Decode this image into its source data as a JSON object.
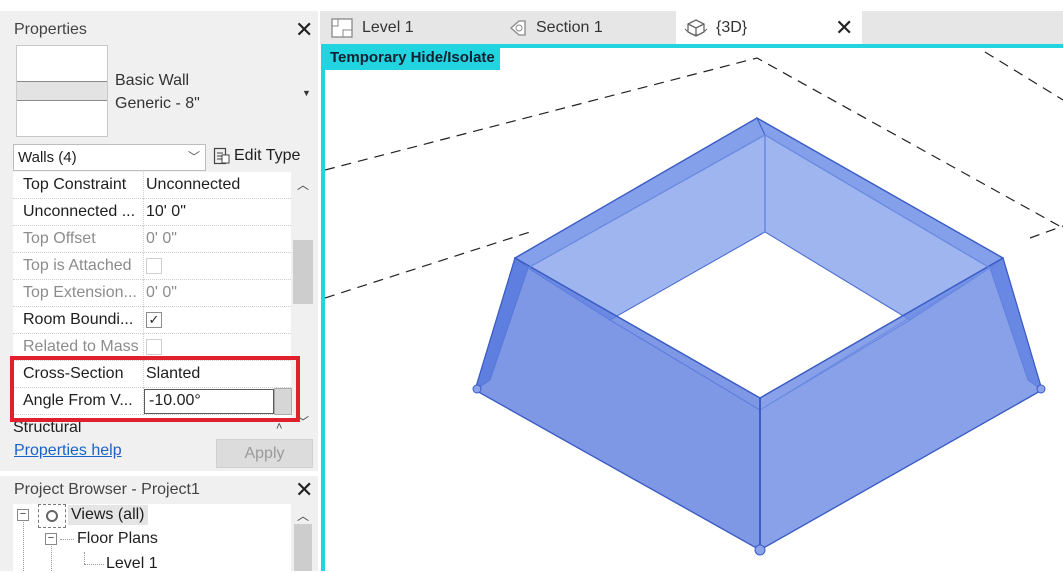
{
  "properties": {
    "title": "Properties",
    "type_family": "Basic Wall",
    "type_name": "Generic - 8\"",
    "selector": "Walls (4)",
    "edit_type": "Edit Type",
    "rows": [
      {
        "name": "Top Constraint",
        "value": "Unconnected",
        "disabled": false
      },
      {
        "name": "Unconnected ...",
        "value": "10'  0\"",
        "disabled": false
      },
      {
        "name": "Top Offset",
        "value": "0'  0\"",
        "disabled": true
      },
      {
        "name": "Top is Attached",
        "checked": false,
        "disabled": true
      },
      {
        "name": "Top Extension...",
        "value": "0'  0\"",
        "disabled": true
      },
      {
        "name": "Room Boundi...",
        "checked": true,
        "disabled": false
      },
      {
        "name": "Related to Mass",
        "checked": false,
        "disabled": true
      },
      {
        "name": "Cross-Section",
        "value": "Slanted",
        "disabled": false
      },
      {
        "name": "Angle From V...",
        "value": "-10.00°",
        "disabled": false,
        "editing": true
      }
    ],
    "section_structural": "Structural",
    "help_link": "Properties help",
    "apply": "Apply"
  },
  "project_browser": {
    "title": "Project Browser - Project1",
    "views_all": "Views (all)",
    "floor_plans": "Floor Plans",
    "level_1": "Level 1"
  },
  "tabs": [
    {
      "label": "Level 1",
      "icon": "floor-plan-icon"
    },
    {
      "label": "Section 1",
      "icon": "section-icon"
    },
    {
      "label": "{3D}",
      "icon": "3d-view-icon",
      "active": true
    }
  ],
  "viewport": {
    "mode_label": "Temporary Hide/Isolate",
    "highlight_color": "#22d3e0",
    "wall_color": "#5b7fe0"
  },
  "colors": {
    "highlight_box": "#e0212b",
    "link": "#1a63c6"
  }
}
